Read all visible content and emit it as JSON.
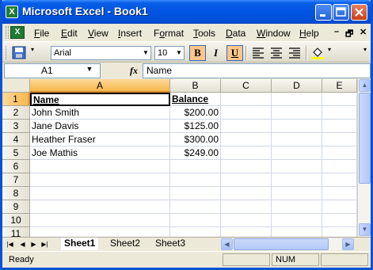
{
  "window": {
    "title": "Microsoft Excel - Book1"
  },
  "menu": {
    "items": [
      {
        "pre": "",
        "u": "F",
        "post": "ile"
      },
      {
        "pre": "",
        "u": "E",
        "post": "dit"
      },
      {
        "pre": "",
        "u": "V",
        "post": "iew"
      },
      {
        "pre": "",
        "u": "I",
        "post": "nsert"
      },
      {
        "pre": "F",
        "u": "o",
        "post": "rmat"
      },
      {
        "pre": "",
        "u": "T",
        "post": "ools"
      },
      {
        "pre": "",
        "u": "D",
        "post": "ata"
      },
      {
        "pre": "",
        "u": "W",
        "post": "indow"
      },
      {
        "pre": "",
        "u": "H",
        "post": "elp"
      }
    ],
    "doc_min": "–",
    "doc_restore": "🗗",
    "doc_close": "✕"
  },
  "toolbar": {
    "font_name": "Arial",
    "font_size": "10",
    "bold": "B",
    "italic": "I",
    "underline": "U"
  },
  "formula_bar": {
    "name_box": "A1",
    "fx": "fx",
    "formula": "Name"
  },
  "columns": [
    "A",
    "B",
    "C",
    "D",
    "E"
  ],
  "rows": [
    "1",
    "2",
    "3",
    "4",
    "5",
    "6",
    "7",
    "8",
    "9",
    "10",
    "11"
  ],
  "cells": {
    "A1": "Name",
    "B1": "Balance",
    "A2": "John Smith",
    "B2": "$200.00",
    "A3": "Jane Davis",
    "B3": "$125.00",
    "A4": "Heather Fraser",
    "B4": "$300.00",
    "A5": "Joe Mathis",
    "B5": "$249.00"
  },
  "sheets": [
    "Sheet1",
    "Sheet2",
    "Sheet3"
  ],
  "active_sheet": "Sheet1",
  "status": {
    "text": "Ready",
    "num": "NUM"
  }
}
